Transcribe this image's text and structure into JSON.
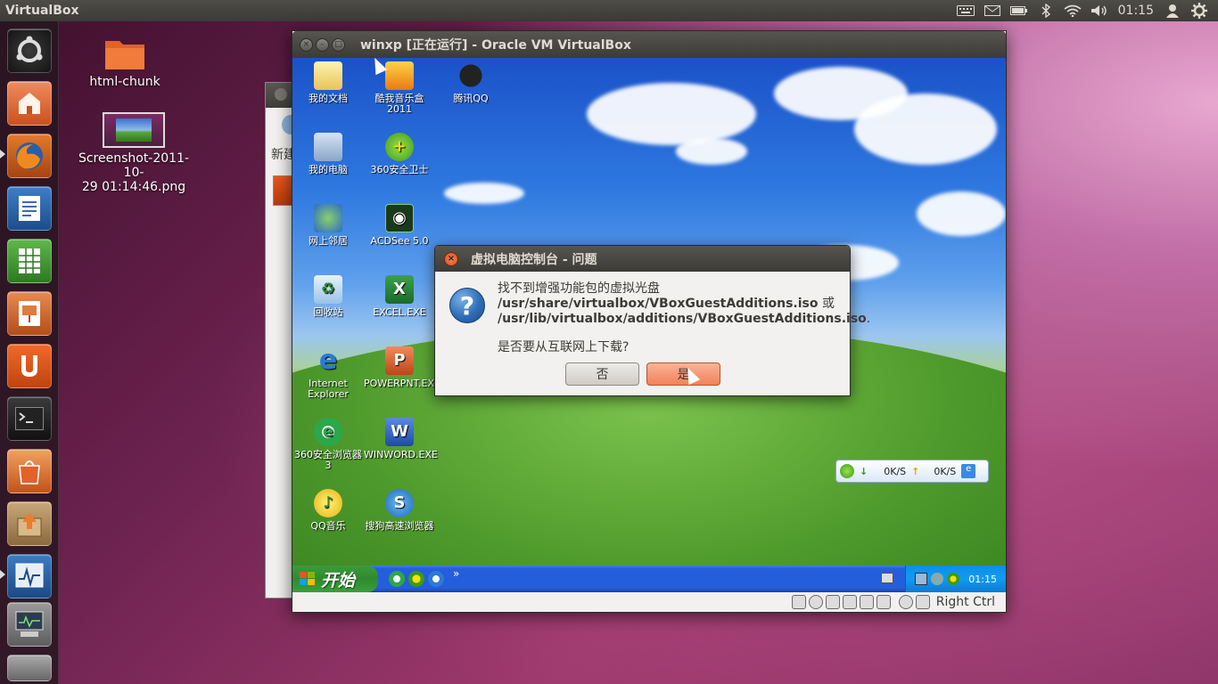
{
  "top_panel": {
    "app_title": "VirtualBox",
    "clock": "01:15"
  },
  "desktop": {
    "folder_label": "html-chunk",
    "screenshot_label_line1": "Screenshot-2011-10-",
    "screenshot_label_line2": "29 01:14:46.png"
  },
  "back_window": {
    "fragment_label": "新建"
  },
  "vbox_window": {
    "title": "winxp [正在运行] - Oracle VM VirtualBox",
    "host_key": "Right Ctrl"
  },
  "guest": {
    "icons": [
      {
        "label": "我的文档"
      },
      {
        "label": "酷我音乐盒 2011"
      },
      {
        "label": "腾讯QQ"
      },
      {
        "label": "我的电脑"
      },
      {
        "label": "360安全卫士"
      },
      {
        "label": "网上邻居"
      },
      {
        "label": "ACDSee 5.0"
      },
      {
        "label": "回收站"
      },
      {
        "label": "EXCEL.EXE"
      },
      {
        "label": "Internet Explorer"
      },
      {
        "label": "POWERPNT.EXE"
      },
      {
        "label": "360安全浏览器 3"
      },
      {
        "label": "WINWORD.EXE"
      },
      {
        "label": "QQ音乐"
      },
      {
        "label": "搜狗高速浏览器"
      }
    ],
    "netspeed": {
      "down": "0K/S",
      "up": "0K/S"
    },
    "taskbar": {
      "start_label": "开始",
      "more": "»",
      "clock": "01:15"
    }
  },
  "dialog": {
    "title": "虚拟电脑控制台 - 问题",
    "message_line1": "找不到增强功能包的虚拟光盘",
    "path1": "/usr/share/virtualbox/VBoxGuestAdditions.iso",
    "or_word": " 或",
    "path2": "/usr/lib/virtualbox/additions/VBoxGuestAdditions.iso",
    "path2_end": ".",
    "question": "是否要从互联网上下载?",
    "no_label": "否",
    "yes_label": "是"
  },
  "icons": {
    "top_tray": [
      "keyboard-icon",
      "mail-icon",
      "battery-icon",
      "bluetooth-icon",
      "wifi-icon",
      "volume-icon"
    ],
    "top_right": [
      "user-icon",
      "power-gear-icon"
    ]
  }
}
